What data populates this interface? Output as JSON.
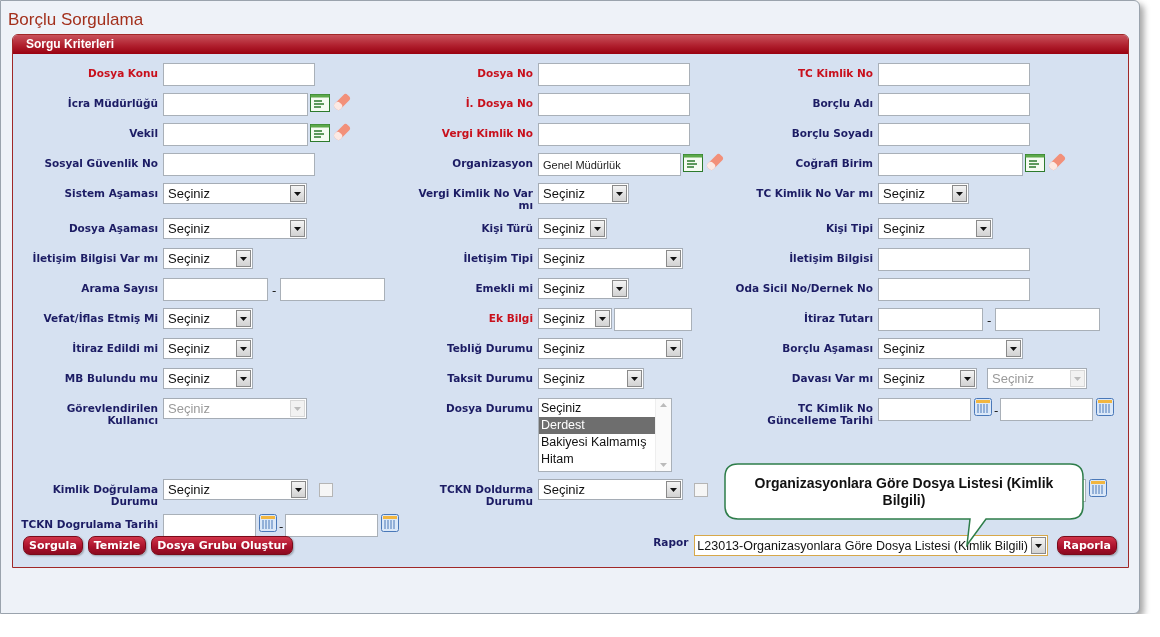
{
  "page_title": "Borçlu Sorgulama",
  "panel": {
    "title": "Sorgu Kriterleri"
  },
  "rows": [
    {
      "cells": [
        {
          "label": "Dosya Konu",
          "required": true,
          "kind": "text"
        },
        {
          "label": "Dosya No",
          "required": true,
          "kind": "text"
        },
        {
          "label": "TC Kimlik No",
          "required": true,
          "kind": "text"
        }
      ]
    },
    {
      "cells": [
        {
          "label": "İcra Müdürlüğü",
          "required": false,
          "kind": "lookup"
        },
        {
          "label": "İ. Dosya No",
          "required": true,
          "kind": "text"
        },
        {
          "label": "Borçlu Adı",
          "required": false,
          "kind": "text"
        }
      ]
    },
    {
      "cells": [
        {
          "label": "Vekil",
          "required": false,
          "kind": "lookup"
        },
        {
          "label": "Vergi Kimlik No",
          "required": true,
          "kind": "text"
        },
        {
          "label": "Borçlu Soyadı",
          "required": false,
          "kind": "text"
        }
      ]
    },
    {
      "cells": [
        {
          "label": "Sosyal Güvenlik No",
          "required": false,
          "kind": "text"
        },
        {
          "label": "Organizasyon",
          "required": false,
          "kind": "lookup",
          "value": "Genel Müdürlük"
        },
        {
          "label": "Coğrafi Birim",
          "required": false,
          "kind": "lookup"
        }
      ]
    },
    {
      "cells": [
        {
          "label": "Sistem Aşaması",
          "required": false,
          "kind": "select",
          "value": "Seçiniz",
          "disabled": false
        },
        {
          "label": "Vergi Kimlik No Var mı",
          "required": false,
          "kind": "select",
          "value": "Seçiniz",
          "disabled": false
        },
        {
          "label": "TC Kimlik No Var mı",
          "required": false,
          "kind": "select",
          "value": "Seçiniz",
          "disabled": false
        }
      ]
    },
    {
      "cells": [
        {
          "label": "Dosya Aşaması",
          "required": false,
          "kind": "select",
          "value": "Seçiniz",
          "disabled": false
        },
        {
          "label": "Kişi Türü",
          "required": false,
          "kind": "select",
          "value": "Seçiniz",
          "disabled": false
        },
        {
          "label": "Kişi Tipi",
          "required": false,
          "kind": "select",
          "value": "Seçiniz",
          "disabled": false
        }
      ]
    },
    {
      "cells": [
        {
          "label": "İletişim Bilgisi Var mı",
          "required": false,
          "kind": "select",
          "value": "Seçiniz",
          "disabled": false
        },
        {
          "label": "İletişim Tipi",
          "required": false,
          "kind": "select",
          "value": "Seçiniz",
          "disabled": false
        },
        {
          "label": "İletişim Bilgisi",
          "required": false,
          "kind": "text"
        }
      ]
    },
    {
      "cells": [
        {
          "label": "Arama Sayısı",
          "required": false,
          "kind": "range",
          "separator": "-"
        },
        {
          "label": "Emekli mi",
          "required": false,
          "kind": "select",
          "value": "Seçiniz",
          "disabled": false
        },
        {
          "label": "Oda Sicil No/Dernek No",
          "required": false,
          "kind": "text"
        }
      ]
    },
    {
      "cells": [
        {
          "label": "Vefat/İflas Etmiş Mi",
          "required": false,
          "kind": "select",
          "value": "Seçiniz",
          "disabled": false
        },
        {
          "label": "Ek Bilgi",
          "required": true,
          "kind": "select_text",
          "value": "Seçiniz",
          "disabled": false
        },
        {
          "label": "İtiraz Tutarı",
          "required": false,
          "kind": "range",
          "separator": "-"
        }
      ]
    },
    {
      "cells": [
        {
          "label": "İtiraz Edildi mi",
          "required": false,
          "kind": "select",
          "value": "Seçiniz",
          "disabled": false
        },
        {
          "label": "Tebliğ Durumu",
          "required": false,
          "kind": "select",
          "value": "Seçiniz",
          "disabled": false
        },
        {
          "label": "Borçlu Aşaması",
          "required": false,
          "kind": "select",
          "value": "Seçiniz",
          "disabled": false
        }
      ]
    },
    {
      "cells": [
        {
          "label": "MB Bulundu mu",
          "required": false,
          "kind": "select",
          "value": "Seçiniz",
          "disabled": false
        },
        {
          "label": "Taksit Durumu",
          "required": false,
          "kind": "select",
          "value": "Seçiniz",
          "disabled": false
        },
        {
          "label": "Davası Var mı",
          "required": false,
          "kind": "select_pair",
          "value": "Seçiniz",
          "disabled": false,
          "second": {
            "value": "Seçiniz",
            "disabled": true
          }
        }
      ]
    },
    {
      "cells": [
        {
          "label": "Görevlendirilen Kullanıcı",
          "required": false,
          "kind": "select",
          "value": "Seçiniz",
          "disabled": true
        },
        {
          "label": "Dosya Durumu",
          "required": false,
          "kind": "listbox",
          "options": [
            {
              "label": "Seçiniz",
              "selected": false
            },
            {
              "label": "Derdest",
              "selected": true
            },
            {
              "label": "Bakiyesi Kalmamış",
              "selected": false
            },
            {
              "label": "Hitam",
              "selected": false
            }
          ]
        },
        {
          "label": "TC Kimlik No Güncelleme Tarihi",
          "required": false,
          "kind": "date_range",
          "separator": "-"
        }
      ]
    },
    {
      "cells": [
        {
          "label": "Kimlik Doğrulama Durumu",
          "required": false,
          "kind": "select_check",
          "value": "Seçiniz",
          "disabled": false,
          "checked": false
        },
        {
          "label": "TCKN Doldurma Durumu",
          "required": false,
          "kind": "select_check",
          "value": "Seçiniz",
          "disabled": false,
          "checked": false
        },
        {
          "kind": "date"
        }
      ]
    },
    {
      "cells": [
        {
          "label": "TCKN Dogrulama Tarihi",
          "required": false,
          "kind": "date_range",
          "separator": "-"
        }
      ]
    }
  ],
  "buttons": [
    "Sorgula",
    "Temizle",
    "Dosya Grubu Oluştur"
  ],
  "report": {
    "label": "Rapor",
    "value": "L23013-Organizasyonlara Göre Dosya Listesi (Kimlik Bilgili)",
    "button": "Raporla"
  },
  "callout": "Organizasyonlara Göre Dosya Listesi (Kimlik Bilgili)"
}
